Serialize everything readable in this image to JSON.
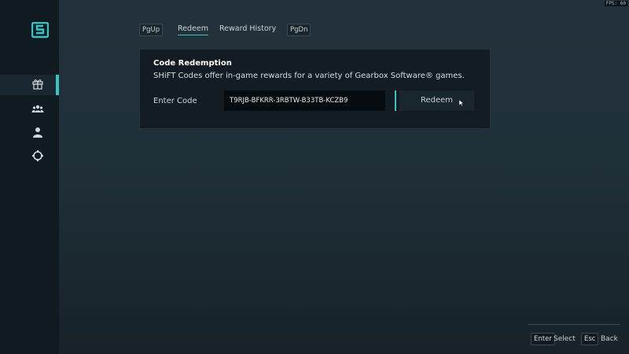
{
  "fps": {
    "label": "FPS: 60"
  },
  "sidebar": {
    "items": [
      {
        "icon": "gift-icon",
        "active": true
      },
      {
        "icon": "friends-icon",
        "active": false
      },
      {
        "icon": "user-icon",
        "active": false
      },
      {
        "icon": "settings-icon",
        "active": false
      }
    ]
  },
  "tabs": {
    "pgup": "PgUp",
    "redeem": "Redeem",
    "reward_history": "Reward History",
    "pgdn": "PgDn"
  },
  "panel": {
    "title": "Code Redemption",
    "description": "SHiFT Codes offer in-game rewards for a variety of Gearbox Software® games.",
    "code_label": "Enter Code",
    "code_value": "T9RJB-BFKRR-3RBTW-B33TB-KCZB9",
    "redeem_label": "Redeem"
  },
  "hints": {
    "enter_key": "Enter",
    "select_label": "Select",
    "esc_key": "Esc",
    "back_label": "Back"
  },
  "colors": {
    "accent": "#35c6c4",
    "background": "#22313b",
    "sidebar": "#101a21",
    "panel": "#121c22"
  }
}
